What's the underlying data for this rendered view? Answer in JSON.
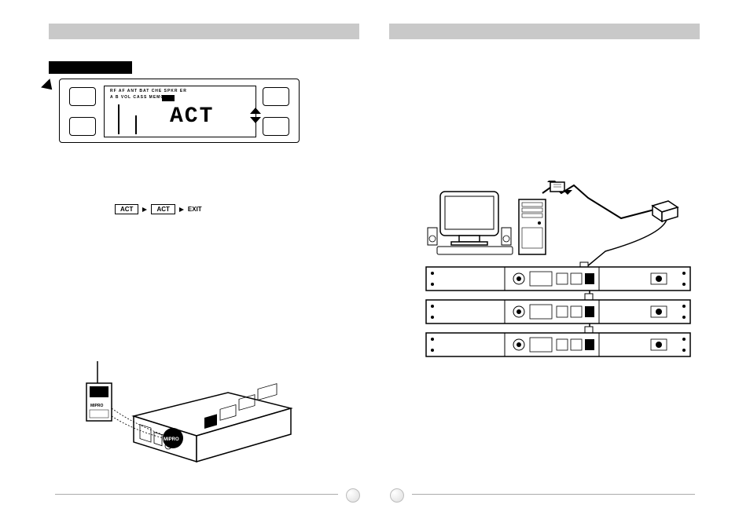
{
  "lcd": {
    "row1": "RF  AF    ANT    BAT   CHE  SPKR   ER",
    "row2": "A  B            VOL  CASS  MEMO",
    "display": "ACT"
  },
  "flow": {
    "box1": "ACT",
    "box2": "ACT",
    "exit": "EXIT"
  },
  "brand": "MIPRO"
}
